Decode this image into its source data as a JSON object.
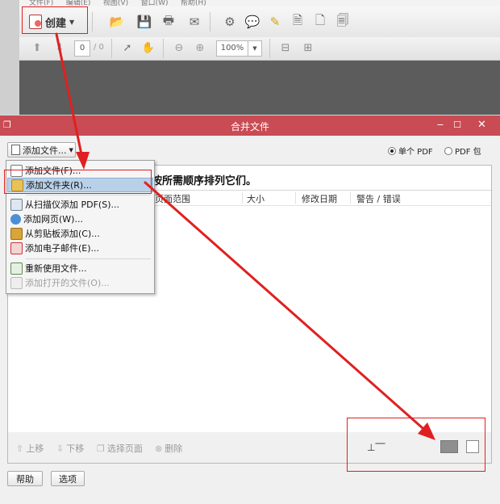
{
  "app": {
    "menu": [
      "文件(F)",
      "编辑(E)",
      "视图(V)",
      "窗口(W)",
      "帮助(H)"
    ],
    "create_label": "创建",
    "page_current": "0",
    "page_total": "/ 0",
    "zoom": "100%"
  },
  "dialog": {
    "title": "合并文件",
    "add_files_label": "添加文件...",
    "radio_single": "单个 PDF",
    "radio_package": "PDF 包",
    "radio_selected": "single",
    "instruction": "按所需顺序排列它们。",
    "columns": [
      "页面范围",
      "大小",
      "修改日期",
      "警告 / 错误"
    ],
    "bottom_tools": [
      "上移",
      "下移",
      "选择页面",
      "删除"
    ],
    "help_label": "帮助",
    "options_label": "选项"
  },
  "menu_items": [
    {
      "label": "添加文件(F)...",
      "icon": "add-file-icon",
      "state": "normal"
    },
    {
      "label": "添加文件夹(R)...",
      "icon": "add-folder-icon",
      "state": "highlighted"
    },
    {
      "label": "从扫描仪添加 PDF(S)...",
      "icon": "scanner-icon",
      "state": "normal"
    },
    {
      "label": "添加网页(W)...",
      "icon": "web-page-icon",
      "state": "normal"
    },
    {
      "label": "从剪贴板添加(C)...",
      "icon": "clipboard-icon",
      "state": "normal"
    },
    {
      "label": "添加电子邮件(E)...",
      "icon": "email-icon",
      "state": "normal"
    },
    {
      "label": "重新使用文件...",
      "icon": "reuse-file-icon",
      "state": "normal"
    },
    {
      "label": "添加打开的文件(O)...",
      "icon": "open-files-icon",
      "state": "disabled"
    }
  ],
  "colors": {
    "titlebar": "#c94b53",
    "annotation_red": "#e02020",
    "menu_highlight": "#b9d1e8"
  }
}
